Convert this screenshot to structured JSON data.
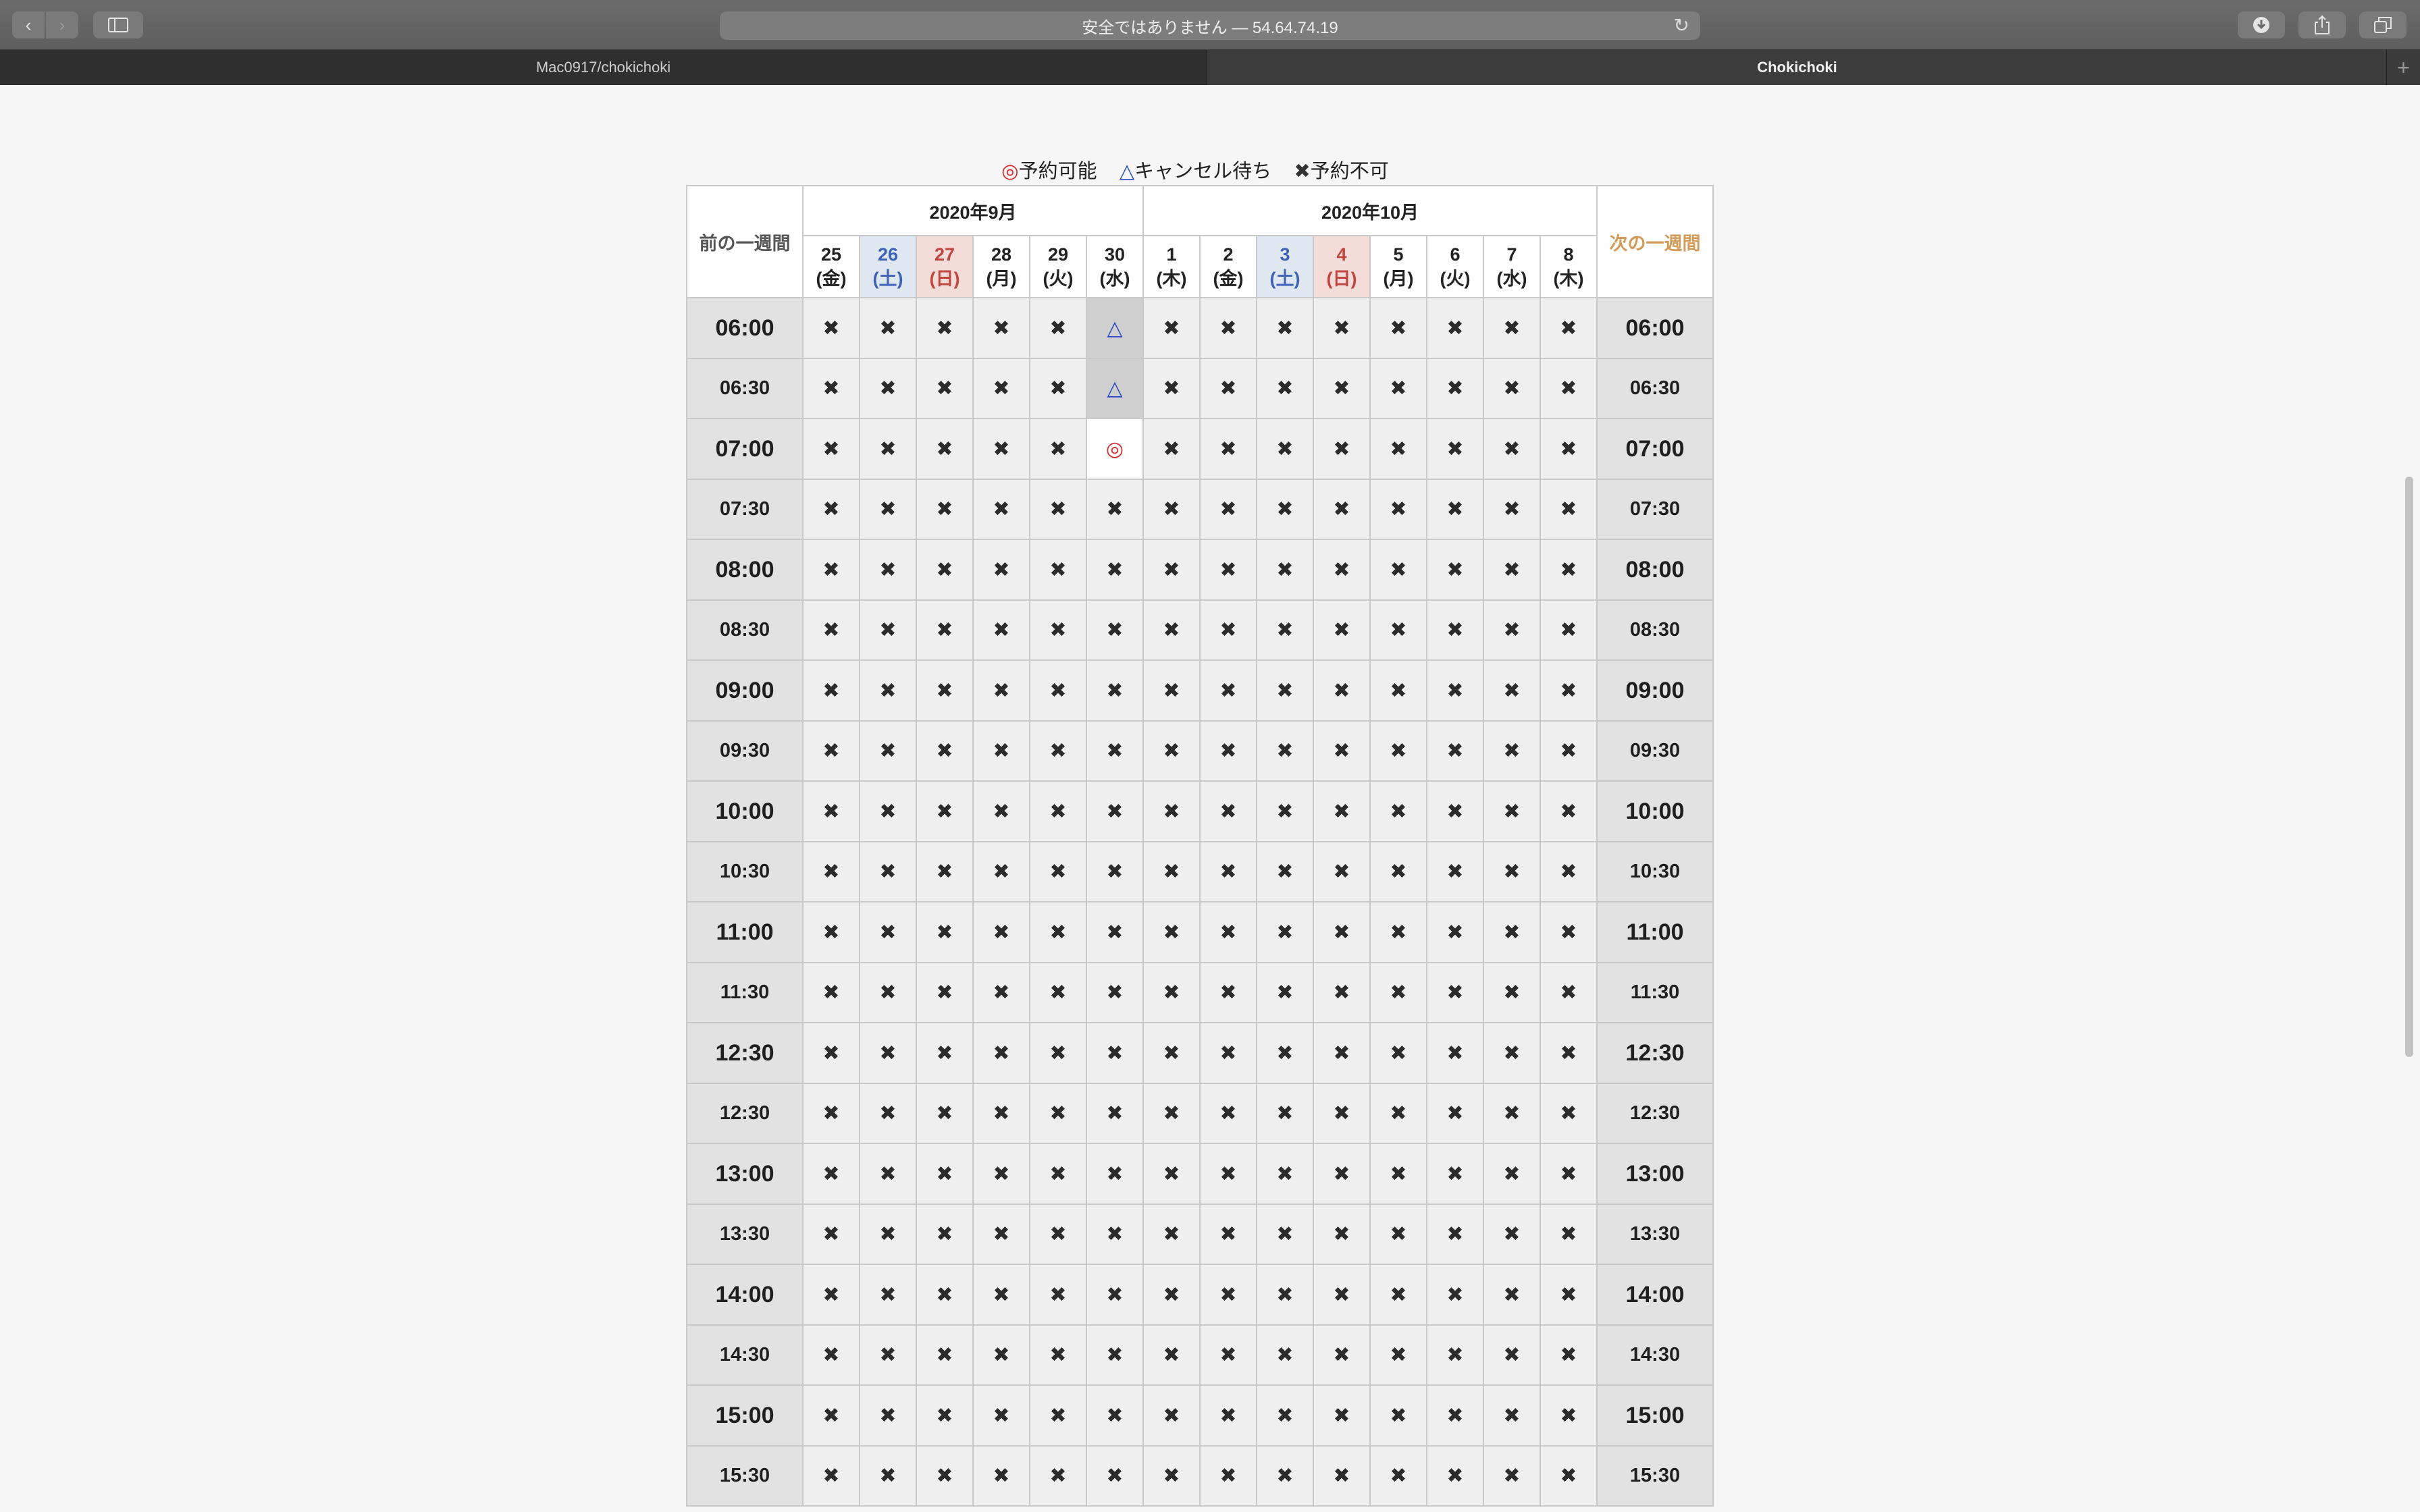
{
  "browser": {
    "address": "安全ではありません — 54.64.74.19",
    "tabs": [
      "Mac0917/chokichoki",
      "Chokichoki"
    ],
    "icons": {
      "back": "chevron-left-icon",
      "forward": "chevron-right-icon",
      "sidebar": "sidebar-icon",
      "reload": "reload-icon",
      "download": "download-icon",
      "share": "share-icon",
      "tabs": "tabs-icon",
      "new_tab": "plus-icon"
    }
  },
  "legend": {
    "available": "◎予約可能",
    "waiting": "△キャンセル待ち",
    "unavailable": "✖予約不可"
  },
  "calendar": {
    "prev_week": "前の一週間",
    "next_week": "次の一週間",
    "months": [
      {
        "label": "2020年9月",
        "span": 6
      },
      {
        "label": "2020年10月",
        "span": 8
      }
    ],
    "days": [
      {
        "day": "25",
        "weekday": "(金)",
        "type": "weekday"
      },
      {
        "day": "26",
        "weekday": "(土)",
        "type": "sat"
      },
      {
        "day": "27",
        "weekday": "(日)",
        "type": "sun"
      },
      {
        "day": "28",
        "weekday": "(月)",
        "type": "weekday"
      },
      {
        "day": "29",
        "weekday": "(火)",
        "type": "weekday"
      },
      {
        "day": "30",
        "weekday": "(水)",
        "type": "weekday"
      },
      {
        "day": "1",
        "weekday": "(木)",
        "type": "weekday"
      },
      {
        "day": "2",
        "weekday": "(金)",
        "type": "weekday"
      },
      {
        "day": "3",
        "weekday": "(土)",
        "type": "sat"
      },
      {
        "day": "4",
        "weekday": "(日)",
        "type": "sun"
      },
      {
        "day": "5",
        "weekday": "(月)",
        "type": "weekday"
      },
      {
        "day": "6",
        "weekday": "(火)",
        "type": "weekday"
      },
      {
        "day": "7",
        "weekday": "(水)",
        "type": "weekday"
      },
      {
        "day": "8",
        "weekday": "(木)",
        "type": "weekday"
      }
    ],
    "symbols": {
      "unavailable": "✖",
      "waiting": "△",
      "available": "◎"
    },
    "rows": [
      {
        "time": "06:00",
        "kind": "hour",
        "slots": [
          "x",
          "x",
          "x",
          "x",
          "x",
          "w",
          "x",
          "x",
          "x",
          "x",
          "x",
          "x",
          "x",
          "x"
        ]
      },
      {
        "time": "06:30",
        "kind": "half",
        "slots": [
          "x",
          "x",
          "x",
          "x",
          "x",
          "w",
          "x",
          "x",
          "x",
          "x",
          "x",
          "x",
          "x",
          "x"
        ]
      },
      {
        "time": "07:00",
        "kind": "hour",
        "slots": [
          "x",
          "x",
          "x",
          "x",
          "x",
          "o",
          "x",
          "x",
          "x",
          "x",
          "x",
          "x",
          "x",
          "x"
        ]
      },
      {
        "time": "07:30",
        "kind": "half",
        "slots": [
          "x",
          "x",
          "x",
          "x",
          "x",
          "x",
          "x",
          "x",
          "x",
          "x",
          "x",
          "x",
          "x",
          "x"
        ]
      },
      {
        "time": "08:00",
        "kind": "hour",
        "slots": [
          "x",
          "x",
          "x",
          "x",
          "x",
          "x",
          "x",
          "x",
          "x",
          "x",
          "x",
          "x",
          "x",
          "x"
        ]
      },
      {
        "time": "08:30",
        "kind": "half",
        "slots": [
          "x",
          "x",
          "x",
          "x",
          "x",
          "x",
          "x",
          "x",
          "x",
          "x",
          "x",
          "x",
          "x",
          "x"
        ]
      },
      {
        "time": "09:00",
        "kind": "hour",
        "slots": [
          "x",
          "x",
          "x",
          "x",
          "x",
          "x",
          "x",
          "x",
          "x",
          "x",
          "x",
          "x",
          "x",
          "x"
        ]
      },
      {
        "time": "09:30",
        "kind": "half",
        "slots": [
          "x",
          "x",
          "x",
          "x",
          "x",
          "x",
          "x",
          "x",
          "x",
          "x",
          "x",
          "x",
          "x",
          "x"
        ]
      },
      {
        "time": "10:00",
        "kind": "hour",
        "slots": [
          "x",
          "x",
          "x",
          "x",
          "x",
          "x",
          "x",
          "x",
          "x",
          "x",
          "x",
          "x",
          "x",
          "x"
        ]
      },
      {
        "time": "10:30",
        "kind": "half",
        "slots": [
          "x",
          "x",
          "x",
          "x",
          "x",
          "x",
          "x",
          "x",
          "x",
          "x",
          "x",
          "x",
          "x",
          "x"
        ]
      },
      {
        "time": "11:00",
        "kind": "hour",
        "slots": [
          "x",
          "x",
          "x",
          "x",
          "x",
          "x",
          "x",
          "x",
          "x",
          "x",
          "x",
          "x",
          "x",
          "x"
        ]
      },
      {
        "time": "11:30",
        "kind": "half",
        "slots": [
          "x",
          "x",
          "x",
          "x",
          "x",
          "x",
          "x",
          "x",
          "x",
          "x",
          "x",
          "x",
          "x",
          "x"
        ]
      },
      {
        "time": "12:30",
        "kind": "hour",
        "slots": [
          "x",
          "x",
          "x",
          "x",
          "x",
          "x",
          "x",
          "x",
          "x",
          "x",
          "x",
          "x",
          "x",
          "x"
        ]
      },
      {
        "time": "12:30",
        "kind": "half",
        "slots": [
          "x",
          "x",
          "x",
          "x",
          "x",
          "x",
          "x",
          "x",
          "x",
          "x",
          "x",
          "x",
          "x",
          "x"
        ]
      },
      {
        "time": "13:00",
        "kind": "hour",
        "slots": [
          "x",
          "x",
          "x",
          "x",
          "x",
          "x",
          "x",
          "x",
          "x",
          "x",
          "x",
          "x",
          "x",
          "x"
        ]
      },
      {
        "time": "13:30",
        "kind": "half",
        "slots": [
          "x",
          "x",
          "x",
          "x",
          "x",
          "x",
          "x",
          "x",
          "x",
          "x",
          "x",
          "x",
          "x",
          "x"
        ]
      },
      {
        "time": "14:00",
        "kind": "hour",
        "slots": [
          "x",
          "x",
          "x",
          "x",
          "x",
          "x",
          "x",
          "x",
          "x",
          "x",
          "x",
          "x",
          "x",
          "x"
        ]
      },
      {
        "time": "14:30",
        "kind": "half",
        "slots": [
          "x",
          "x",
          "x",
          "x",
          "x",
          "x",
          "x",
          "x",
          "x",
          "x",
          "x",
          "x",
          "x",
          "x"
        ]
      },
      {
        "time": "15:00",
        "kind": "hour",
        "slots": [
          "x",
          "x",
          "x",
          "x",
          "x",
          "x",
          "x",
          "x",
          "x",
          "x",
          "x",
          "x",
          "x",
          "x"
        ]
      },
      {
        "time": "15:30",
        "kind": "half",
        "slots": [
          "x",
          "x",
          "x",
          "x",
          "x",
          "x",
          "x",
          "x",
          "x",
          "x",
          "x",
          "x",
          "x",
          "x"
        ]
      }
    ]
  }
}
